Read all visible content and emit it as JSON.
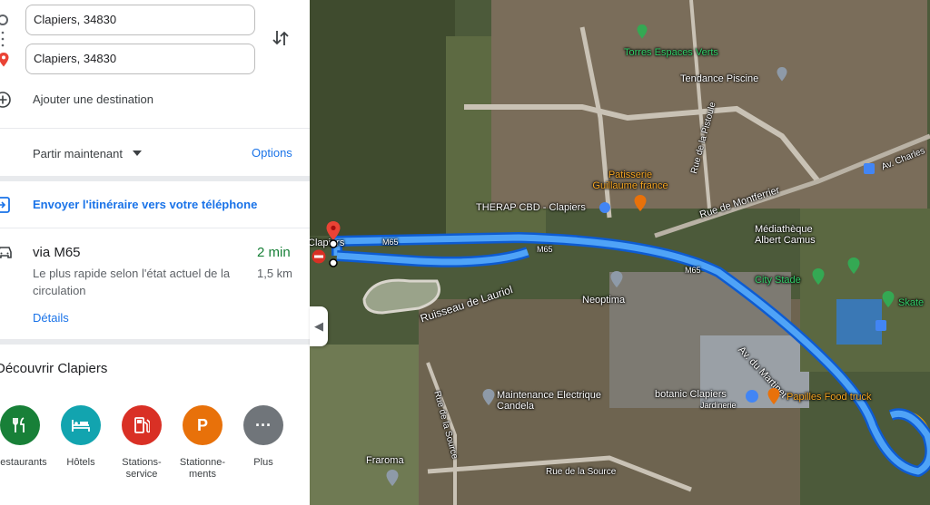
{
  "directions": {
    "origin": "Clapiers, 34830",
    "destination": "Clapiers, 34830",
    "add_destination": "Ajouter une destination"
  },
  "departure": {
    "label": "Partir maintenant",
    "options_label": "Options"
  },
  "send_to_phone": "Envoyer l'itinéraire vers votre téléphone",
  "route": {
    "name": "via M65",
    "duration": "2 min",
    "description": "Le plus rapide selon l'état actuel de la circulation",
    "distance": "1,5 km",
    "details_label": "Détails"
  },
  "discover": {
    "title": "Découvrir Clapiers",
    "categories": [
      {
        "label": "Restaurants",
        "icon": "restaurant-icon",
        "color": "#188038"
      },
      {
        "label": "Hôtels",
        "icon": "hotel-icon",
        "color": "#12a4af"
      },
      {
        "label": "Stations-service",
        "icon": "gas-station-icon",
        "color": "#d93025"
      },
      {
        "label": "Stationne-ments",
        "icon": "parking-icon",
        "color": "#e8710a"
      },
      {
        "label": "Plus",
        "icon": "more-icon",
        "color": "#70757a"
      }
    ]
  },
  "map": {
    "road_labels": [
      "M65",
      "M65",
      "M65",
      "Av. du Martinet",
      "Rue de Montferrier",
      "Ruisseau de Lauriol",
      "Rue de la Source",
      "Rue de la Source",
      "Av. Charles",
      "Rue de la Pistoule"
    ],
    "places": [
      "Torres Espaces Verts",
      "Tendance Piscine",
      "Patisserie Guillaume france",
      "THERAP CBD - Clapiers",
      "Médiathèque Albert Camus",
      "City Stade",
      "Neoptima",
      "Maintenance Electrique Candela",
      "botanic Clapiers",
      "Jardinerie",
      "Papilles Food truck",
      "Fraroma",
      "Skate"
    ],
    "origin_marker_label": "Clapiers",
    "route_color": "#1a73e8",
    "alt_route_color": "#f9ab00"
  }
}
